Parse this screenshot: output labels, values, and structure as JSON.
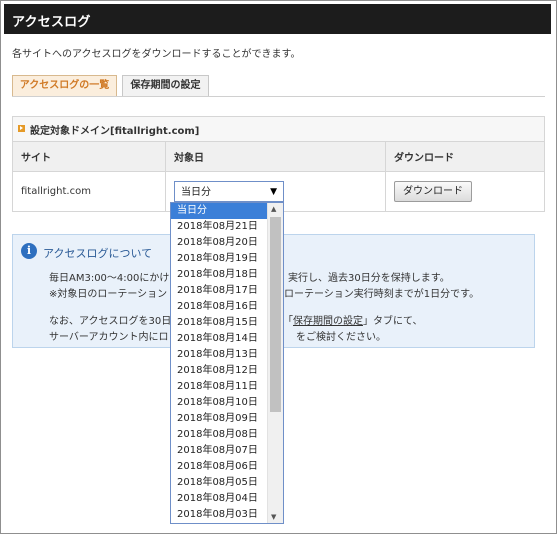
{
  "header": {
    "title": "アクセスログ"
  },
  "description": "各サイトへのアクセスログをダウンロードすることができます。",
  "tabs": [
    {
      "label": "アクセスログの一覧",
      "active": true
    },
    {
      "label": "保存期間の設定",
      "active": false
    }
  ],
  "panel": {
    "title": "設定対象ドメイン[fitallright.com]",
    "columns": [
      "サイト",
      "対象日",
      "ダウンロード"
    ],
    "row": {
      "site": "fitallright.com",
      "selected_date": "当日分",
      "download_label": "ダウンロード"
    }
  },
  "info": {
    "icon": "i",
    "heading": "アクセスログについて",
    "line1": "毎日AM3:00～4:00にかけ",
    "line1b": "実行し、過去30日分を保持します。",
    "line2": "※対象日のローテーション",
    "line2b": "ローテーション実行時刻までが1日分です。",
    "line3": "なお、アクセスログを30日",
    "line3_link": "保存期間の設定",
    "line3b": "」タブにて、",
    "line4": "サーバーアカウント内にロ",
    "line4b": "をご検討ください。"
  },
  "dropdown": {
    "options": [
      "当日分",
      "2018年08月21日",
      "2018年08月20日",
      "2018年08月19日",
      "2018年08月18日",
      "2018年08月17日",
      "2018年08月16日",
      "2018年08月15日",
      "2018年08月14日",
      "2018年08月13日",
      "2018年08月12日",
      "2018年08月11日",
      "2018年08月10日",
      "2018年08月09日",
      "2018年08月08日",
      "2018年08月07日",
      "2018年08月06日",
      "2018年08月05日",
      "2018年08月04日",
      "2018年08月03日"
    ],
    "highlighted_index": 0
  },
  "colors": {
    "header_bg": "#1c1c1c",
    "active_tab_text": "#d07a26",
    "info_bg": "#e9f1fa",
    "highlight": "#3b7fd8"
  }
}
